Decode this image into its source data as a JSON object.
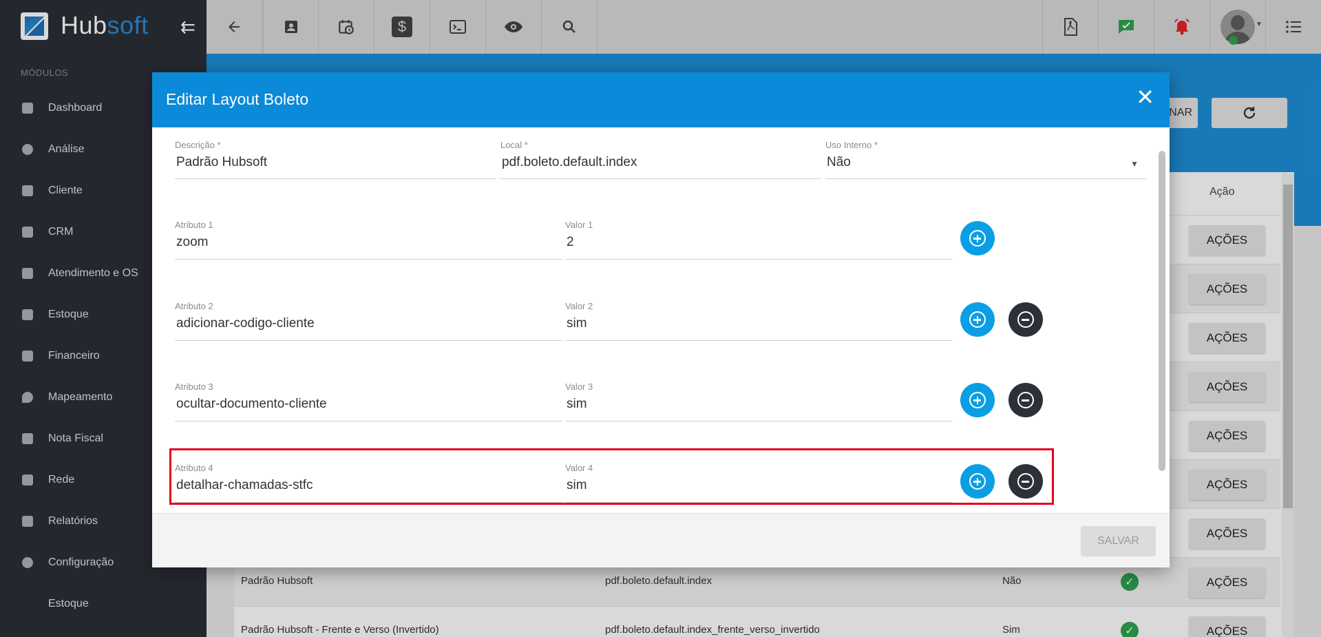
{
  "app": {
    "logo_main": "Hub",
    "logo_accent": "soft"
  },
  "sidebar": {
    "section": "MÓDULOS",
    "items": [
      {
        "label": "Dashboard"
      },
      {
        "label": "Análise"
      },
      {
        "label": "Cliente"
      },
      {
        "label": "CRM"
      },
      {
        "label": "Atendimento e OS"
      },
      {
        "label": "Estoque"
      },
      {
        "label": "Financeiro"
      },
      {
        "label": "Mapeamento"
      },
      {
        "label": "Nota Fiscal"
      },
      {
        "label": "Rede"
      },
      {
        "label": "Relatórios"
      },
      {
        "label": "Configuração"
      },
      {
        "label": "Estoque"
      }
    ]
  },
  "toolbar": {
    "dollar": "$"
  },
  "background_page": {
    "btn_partial": "NAR",
    "col_acao": "Ação",
    "actions_label": "AÇÕES",
    "rows": [
      {
        "descricao": "Padrão Hubsoft",
        "local": "pdf.boleto.default.index",
        "uso": "Não"
      },
      {
        "descricao": "Padrão Hubsoft - Frente e Verso (Invertido)",
        "local": "pdf.boleto.default.index_frente_verso_invertido",
        "uso": "Sim"
      }
    ]
  },
  "modal": {
    "title": "Editar Layout Boleto",
    "descricao": {
      "label": "Descrição",
      "value": "Padrão Hubsoft"
    },
    "local": {
      "label": "Local",
      "value": "pdf.boleto.default.index"
    },
    "uso_interno": {
      "label": "Uso Interno",
      "value": "Não"
    },
    "required_mark": "*",
    "attributes": [
      {
        "attr_label": "Atributo 1",
        "attr_value": "zoom",
        "val_label": "Valor 1",
        "val_value": "2"
      },
      {
        "attr_label": "Atributo 2",
        "attr_value": "adicionar-codigo-cliente",
        "val_label": "Valor 2",
        "val_value": "sim"
      },
      {
        "attr_label": "Atributo 3",
        "attr_value": "ocultar-documento-cliente",
        "val_label": "Valor 3",
        "val_value": "sim"
      },
      {
        "attr_label": "Atributo 4",
        "attr_value": "detalhar-chamadas-stfc",
        "val_label": "Valor 4",
        "val_value": "sim"
      }
    ],
    "save_label": "SALVAR",
    "close_glyph": "✕"
  }
}
